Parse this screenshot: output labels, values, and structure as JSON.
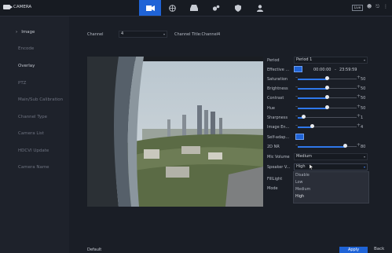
{
  "app_title": "CAMERA",
  "top_icons": [
    "camera-icon",
    "network-icon",
    "storage-icon",
    "settings-icon",
    "security-icon",
    "account-icon"
  ],
  "top_right": {
    "badge": "Live"
  },
  "sidebar": {
    "items": [
      {
        "label": "Image"
      },
      {
        "label": "Encode"
      },
      {
        "label": "Overlay"
      },
      {
        "label": "PTZ"
      },
      {
        "label": "Main/Sub Calibration"
      },
      {
        "label": "Channel Type"
      },
      {
        "label": "Camera List"
      },
      {
        "label": "HDCVI Update"
      },
      {
        "label": "Camera Name"
      }
    ]
  },
  "channel": {
    "label": "Channel",
    "value": "4",
    "title": "Channel Title:Channel4"
  },
  "settings": {
    "period": {
      "label": "Period",
      "value": "Period 1"
    },
    "effective": {
      "label": "Effective ...",
      "start": "00:00:00",
      "separator": "-",
      "end": "23:59:59"
    },
    "saturation": {
      "label": "Saturation",
      "value": "50",
      "level": 0.5
    },
    "brightness": {
      "label": "Brightness",
      "value": "50",
      "level": 0.5
    },
    "contrast": {
      "label": "Contrast",
      "value": "50",
      "level": 0.5
    },
    "hue": {
      "label": "Hue",
      "value": "50",
      "level": 0.5
    },
    "sharpness": {
      "label": "Sharpness",
      "value": "1",
      "level": 0.1
    },
    "image_en": {
      "label": "Image En...",
      "value": "4",
      "level": 0.25
    },
    "self_adapt": {
      "label": "Self-adap..."
    },
    "dnr_2d": {
      "label": "2D NR",
      "value": "80",
      "level": 0.8
    },
    "mic_volume": {
      "label": "Mic Volume",
      "value": "Medium"
    },
    "speaker": {
      "label": "Speaker V...",
      "value": "High"
    },
    "fill_light": {
      "label": "FillLight"
    },
    "mode": {
      "label": "Mode"
    },
    "dropdown_options": [
      "Disable",
      "Low",
      "Medium",
      "High"
    ]
  },
  "footer": {
    "default": "Default",
    "apply": "Apply",
    "back": "Back"
  },
  "colors": {
    "accent": "#1f63d6",
    "background": "#1a1e26"
  }
}
